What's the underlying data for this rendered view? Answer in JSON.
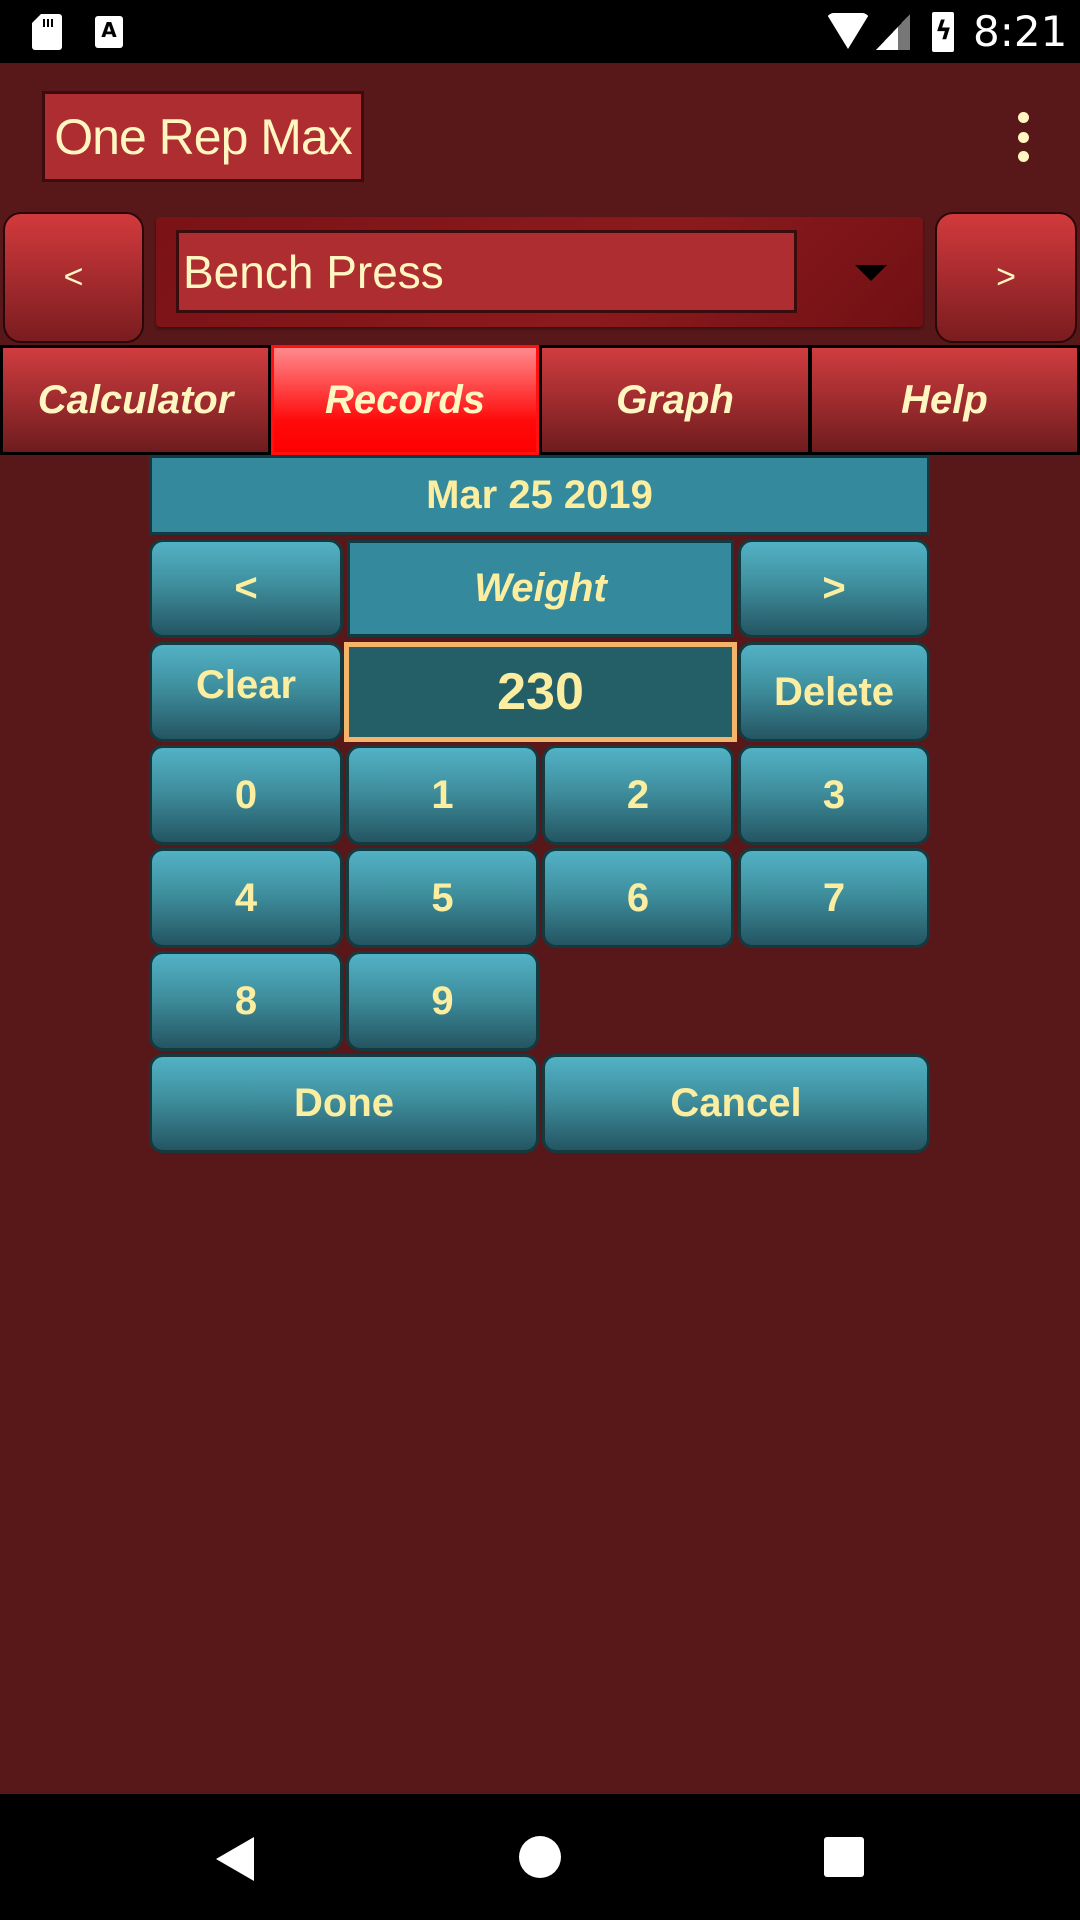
{
  "status_bar": {
    "time": "8:21",
    "icons": [
      "sd-card-icon",
      "accessibility-a-icon",
      "wifi-icon",
      "cell-signal-icon",
      "battery-charging-icon"
    ],
    "a_glyph": "A"
  },
  "app_bar": {
    "title": "One Rep Max",
    "menu_icon": "overflow-menu-icon"
  },
  "exercise_selector": {
    "prev_label": "<",
    "next_label": ">",
    "selected": "Bench Press",
    "dropdown_icon": "dropdown-arrow-icon"
  },
  "tabs": [
    {
      "label": "Calculator",
      "active": false
    },
    {
      "label": "Records",
      "active": true
    },
    {
      "label": "Graph",
      "active": false
    },
    {
      "label": "Help",
      "active": false
    }
  ],
  "record_editor": {
    "date": "Mar 25 2019",
    "prev_field_label": "<",
    "next_field_label": ">",
    "field_label": "Weight",
    "value": "230",
    "clear_label": "Clear",
    "delete_label": "Delete",
    "digits": [
      "0",
      "1",
      "2",
      "3",
      "4",
      "5",
      "6",
      "7",
      "8",
      "9"
    ],
    "done_label": "Done",
    "cancel_label": "Cancel"
  },
  "colors": {
    "background": "#58181a",
    "accent_red": "#ad2d31",
    "active_tab": "#ff0000",
    "teal": "#348a9c",
    "text_cream": "#fbeea0",
    "value_border": "#f4b46a"
  },
  "nav_bar": {
    "icons": [
      "back-icon",
      "home-icon",
      "recents-icon"
    ]
  }
}
